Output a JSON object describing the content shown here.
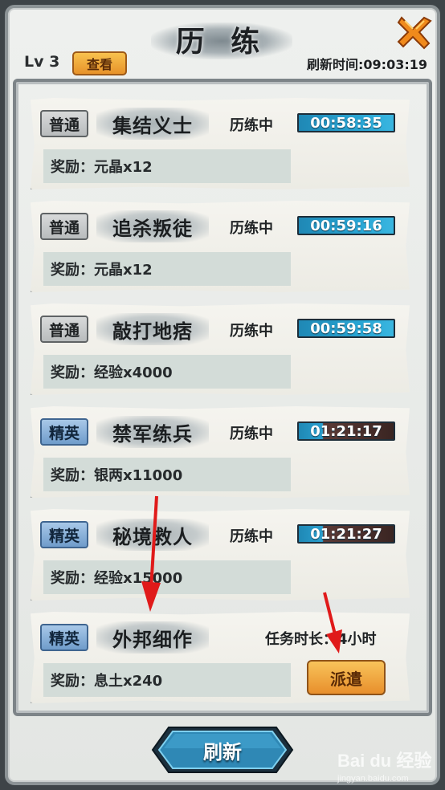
{
  "header": {
    "title": "历 练",
    "level": "Lv 3",
    "view_label": "查看",
    "refresh_time": "刷新时间:09:03:19"
  },
  "tasks": [
    {
      "grade": "普通",
      "grade_type": "normal",
      "name": "集结义士",
      "status": "历练中",
      "timer": "00:58:35",
      "reward": "奖励：元晶x12"
    },
    {
      "grade": "普通",
      "grade_type": "normal",
      "name": "追杀叛徒",
      "status": "历练中",
      "timer": "00:59:16",
      "reward": "奖励：元晶x12"
    },
    {
      "grade": "普通",
      "grade_type": "normal",
      "name": "敲打地痞",
      "status": "历练中",
      "timer": "00:59:58",
      "reward": "奖励：经验x4000"
    },
    {
      "grade": "精英",
      "grade_type": "elite",
      "name": "禁军练兵",
      "status": "历练中",
      "timer": "01:21:17",
      "reward": "奖励：银两x11000"
    },
    {
      "grade": "精英",
      "grade_type": "elite",
      "name": "秘境救人",
      "status": "历练中",
      "timer": "01:21:27",
      "reward": "奖励：经验x15000"
    },
    {
      "grade": "精英",
      "grade_type": "elite",
      "name": "外邦细作",
      "duration": "任务时长：4小时",
      "reward": "奖励：息土x240",
      "dispatch_label": "派遣"
    }
  ],
  "footer": {
    "refresh_label": "刷新"
  },
  "watermark": {
    "logo": "Bai du 经验",
    "sub": "jingyan.baidu.com"
  },
  "colors": {
    "accent_orange": "#e88f2c",
    "timer_blue": "#2aa8d6",
    "elite_blue": "#6f9ccb",
    "arrow_red": "#e01a1a"
  },
  "icons": {
    "close": "close-x-icon"
  }
}
